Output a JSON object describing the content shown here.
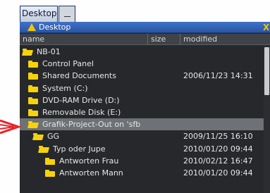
{
  "tabs": {
    "active_label": "Desktop",
    "inactive_label": ""
  },
  "window": {
    "title": "Desktop",
    "close_glyph": "X"
  },
  "columns": {
    "name": "name",
    "size": "size",
    "modified": "modified"
  },
  "rows": [
    {
      "indent": 0,
      "icon": "folder-open-icon",
      "name": "NB-01",
      "size": "",
      "modified": "",
      "selected": false
    },
    {
      "indent": 1,
      "icon": "folder-icon",
      "name": "Control Panel",
      "size": "",
      "modified": "",
      "selected": false
    },
    {
      "indent": 1,
      "icon": "folder-icon",
      "name": "Shared Documents",
      "size": "",
      "modified": "2006/11/23 14:31",
      "selected": false
    },
    {
      "indent": 1,
      "icon": "folder-icon",
      "name": "System (C:)",
      "size": "",
      "modified": "",
      "selected": false
    },
    {
      "indent": 1,
      "icon": "folder-icon",
      "name": "DVD-RAM Drive (D:)",
      "size": "",
      "modified": "",
      "selected": false
    },
    {
      "indent": 1,
      "icon": "folder-icon",
      "name": "Removable Disk (E:)",
      "size": "",
      "modified": "",
      "selected": false
    },
    {
      "indent": 1,
      "icon": "folder-open-icon",
      "name": "Grafik-Project-Out on 'sfb",
      "size": "",
      "modified": "",
      "selected": true
    },
    {
      "indent": 2,
      "icon": "folder-open-icon",
      "name": "GG",
      "size": "",
      "modified": "2009/11/25 16:10",
      "selected": false
    },
    {
      "indent": 3,
      "icon": "folder-open-icon",
      "name": "Typ oder Jupe",
      "size": "",
      "modified": "2010/01/20 09:44",
      "selected": false
    },
    {
      "indent": 4,
      "icon": "folder-icon",
      "name": "Antworten Frau",
      "size": "",
      "modified": "2010/02/12 16:47",
      "selected": false
    },
    {
      "indent": 4,
      "icon": "folder-icon",
      "name": "Antworten Mann",
      "size": "",
      "modified": "2010/01/20 09:44",
      "selected": false
    }
  ],
  "colors": {
    "pane_bg": "#26282b",
    "titlebar": "#2a55a3",
    "folder": "#f6d20b",
    "pointer_arrow": "#e8222a"
  }
}
